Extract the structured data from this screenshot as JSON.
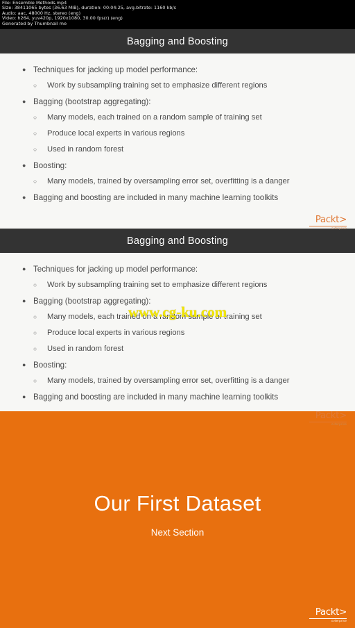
{
  "info_bar": {
    "lines": [
      "File: Ensemble Methods.mp4",
      "Size: 38411065 bytes (36.63 MiB), duration: 00:04:25, avg.bitrate: 1160 kb/s",
      "Audio: aac, 48000 Hz, stereo (eng)",
      "Video: h264, yuv420p, 1920x1080, 30.00 fps(r) (eng)",
      "Generated by Thumbnail me"
    ]
  },
  "slides": [
    {
      "title": "Bagging and Boosting",
      "bullets": [
        {
          "level": 1,
          "marker": "●",
          "text": "Techniques for jacking up model performance:"
        },
        {
          "level": 2,
          "marker": "○",
          "text": "Work by subsampling training set to emphasize different regions"
        },
        {
          "level": 1,
          "marker": "●",
          "text": "Bagging (bootstrap aggregating):"
        },
        {
          "level": 2,
          "marker": "○",
          "text": "Many models, each trained on a random sample of training set"
        },
        {
          "level": 2,
          "marker": "○",
          "text": "Produce local experts in various regions"
        },
        {
          "level": 2,
          "marker": "○",
          "text": "Used in random forest"
        },
        {
          "level": 1,
          "marker": "●",
          "text": "Boosting:"
        },
        {
          "level": 2,
          "marker": "○",
          "text": "Many models, trained by oversampling error set, overfitting is a danger"
        },
        {
          "level": 1,
          "marker": "●",
          "text": "Bagging and boosting are included in many machine learning toolkits"
        }
      ]
    },
    {
      "title": "Bagging and Boosting",
      "bullets": [
        {
          "level": 1,
          "marker": "●",
          "text": "Techniques for jacking up model performance:"
        },
        {
          "level": 2,
          "marker": "○",
          "text": "Work by subsampling training set to emphasize different regions"
        },
        {
          "level": 1,
          "marker": "●",
          "text": "Bagging (bootstrap aggregating):"
        },
        {
          "level": 2,
          "marker": "○",
          "text": "Many models, each trained on a random sample of training set"
        },
        {
          "level": 2,
          "marker": "○",
          "text": "Produce local experts in various regions"
        },
        {
          "level": 2,
          "marker": "○",
          "text": "Used in random forest"
        },
        {
          "level": 1,
          "marker": "●",
          "text": "Boosting:"
        },
        {
          "level": 2,
          "marker": "○",
          "text": "Many models, trained by oversampling error set, overfitting is a danger"
        },
        {
          "level": 1,
          "marker": "●",
          "text": "Bagging and boosting are included in many machine learning toolkits"
        }
      ]
    }
  ],
  "section_slide": {
    "title": "Our First Dataset",
    "subtitle": "Next Section",
    "background_color": "#e8700f"
  },
  "logo": {
    "word": "Packt>",
    "sub": "ενterprise"
  },
  "watermark": {
    "text": "www.cg-ku.com",
    "color": "#f2e600"
  },
  "colors": {
    "title_bar": "#333333",
    "slide_background": "#f7f7f5",
    "accent_orange": "#e8700f",
    "logo_orange": "#e07b39"
  }
}
